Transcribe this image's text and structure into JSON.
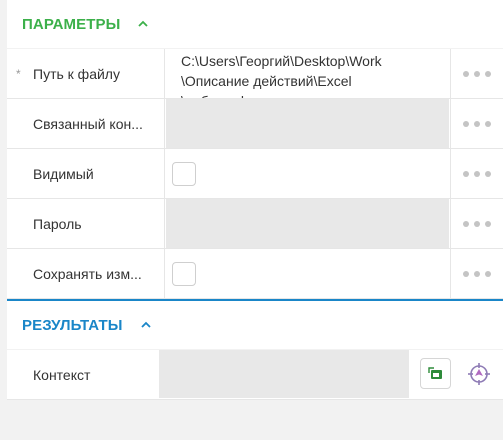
{
  "params_section": {
    "title": "ПАРАМЕТРЫ"
  },
  "results_section": {
    "title": "РЕЗУЛЬТАТЫ"
  },
  "params": [
    {
      "label": "Путь к файлу",
      "required_mark": "*",
      "value": "C:\\Users\\Георгий\\Desktop\\Work\n\\Описание действий\\Excel\n\\работа.xlsx"
    },
    {
      "label": "Связанный кон..."
    },
    {
      "label": "Видимый"
    },
    {
      "label": "Пароль"
    },
    {
      "label": "Сохранять изм..."
    }
  ],
  "results": [
    {
      "label": "Контекст"
    }
  ],
  "colors": {
    "params_accent": "#3cb04a",
    "results_accent": "#1a86c8"
  },
  "icons": {
    "collapse": "chevron-up-icon",
    "more": "more-dots-icon",
    "select": "select-element-icon",
    "target": "target-icon"
  }
}
